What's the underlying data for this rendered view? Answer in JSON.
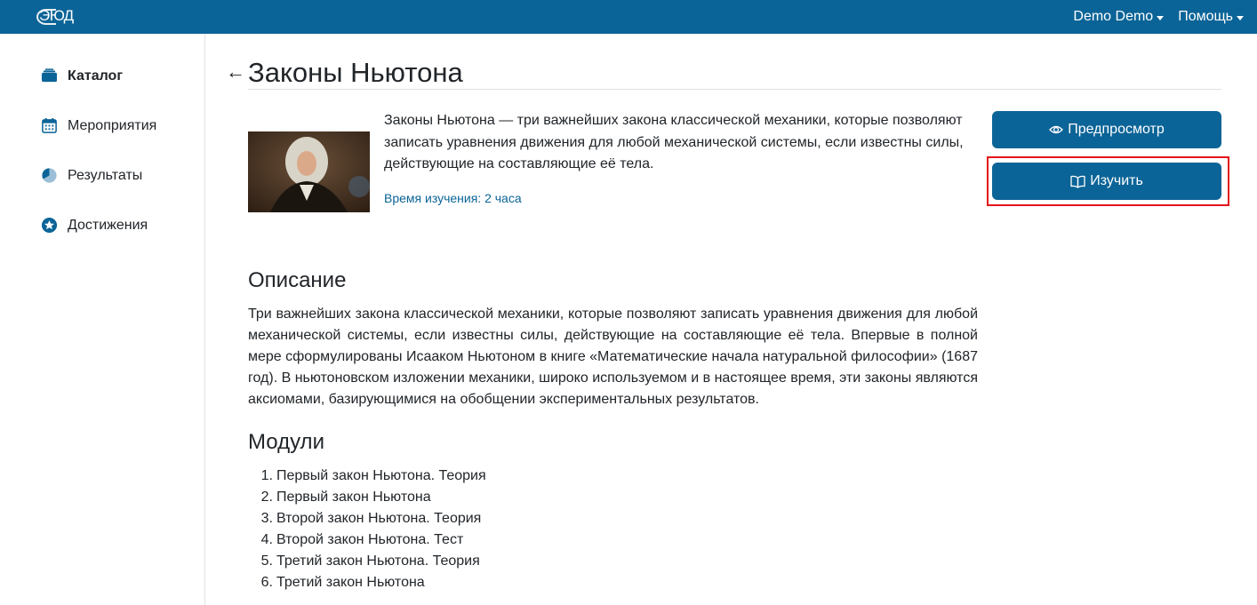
{
  "header": {
    "logo_text": "ЭЮД",
    "user_menu": "Demo Demo",
    "help_menu": "Помощь"
  },
  "sidebar": {
    "items": [
      {
        "label": "Каталог",
        "icon": "catalog-icon",
        "active": true
      },
      {
        "label": "Мероприятия",
        "icon": "calendar-icon",
        "active": false
      },
      {
        "label": "Результаты",
        "icon": "pie-chart-icon",
        "active": false
      },
      {
        "label": "Достижения",
        "icon": "star-badge-icon",
        "active": false
      }
    ]
  },
  "course": {
    "back_icon": "←",
    "title": "Законы Ньютона",
    "intro": "Законы Ньютона — три важнейших закона классической механики, которые позволяют записать уравнения движения для любой механической системы, если известны силы, действующие на составляющие её тела.",
    "duration": "Время изучения: 2 часа",
    "preview_label": "Предпросмотр",
    "study_label": "Изучить"
  },
  "description": {
    "heading": "Описание",
    "text": "Три важнейших закона классической механики, которые позволяют записать уравнения движения для любой механической системы, если известны силы, действующие на составляющие её тела. Впервые в полной мере сформулированы Исааком Ньютоном в книге «Математические начала натуральной философии» (1687 год). В ньютоновском изложении механики, широко используемом и в настоящее время, эти законы являются аксиомами, базирующимися на обобщении экспериментальных результатов."
  },
  "modules": {
    "heading": "Модули",
    "items": [
      {
        "num": "1.",
        "label": "Первый закон Ньютона. Теория"
      },
      {
        "num": "2.",
        "label": "Первый закон Ньютона"
      },
      {
        "num": "3.",
        "label": "Второй закон Ньютона. Теория"
      },
      {
        "num": "4.",
        "label": "Второй закон Ньютона. Тест"
      },
      {
        "num": "5.",
        "label": "Третий закон Ньютона. Теория"
      },
      {
        "num": "6.",
        "label": "Третий закон Ньютона"
      }
    ]
  },
  "colors": {
    "brand": "#0b6497",
    "highlight": "#e3141b"
  }
}
